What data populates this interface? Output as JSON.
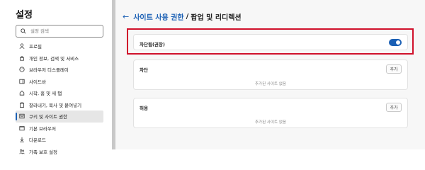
{
  "sidebar": {
    "title": "설정",
    "search_placeholder": "설정 검색",
    "items": [
      {
        "label": "프로필",
        "icon": "person-icon",
        "active": false
      },
      {
        "label": "개인 정보, 검색 및 서비스",
        "icon": "lock-icon",
        "active": false
      },
      {
        "label": "브라우저 디스플레이",
        "icon": "brush-icon",
        "active": false
      },
      {
        "label": "사이드바",
        "icon": "sidebar-icon",
        "active": false
      },
      {
        "label": "시작, 홈 및 새 탭",
        "icon": "home-icon",
        "active": false
      },
      {
        "label": "잘라내기, 복사 및 붙여넣기",
        "icon": "clipboard-icon",
        "active": false
      },
      {
        "label": "쿠키 및 사이트 권한",
        "icon": "cookie-icon",
        "active": true
      },
      {
        "label": "기본 브라우저",
        "icon": "browser-icon",
        "active": false
      },
      {
        "label": "다운로드",
        "icon": "download-icon",
        "active": false
      },
      {
        "label": "가족 보호 설정",
        "icon": "family-icon",
        "active": false
      }
    ]
  },
  "breadcrumb": {
    "parent": "사이트 사용 권한",
    "separator": "/",
    "current": "팝업 및 리디렉션"
  },
  "toggle_setting": {
    "label": "차단됨(권장)",
    "enabled": true
  },
  "block_section": {
    "title": "차단",
    "add_label": "추가",
    "empty_text": "추가된 사이트 없음"
  },
  "allow_section": {
    "title": "허용",
    "add_label": "추가",
    "empty_text": "추가된 사이트 없음"
  },
  "colors": {
    "accent": "#1a5fb4",
    "highlight": "#d0112b"
  }
}
